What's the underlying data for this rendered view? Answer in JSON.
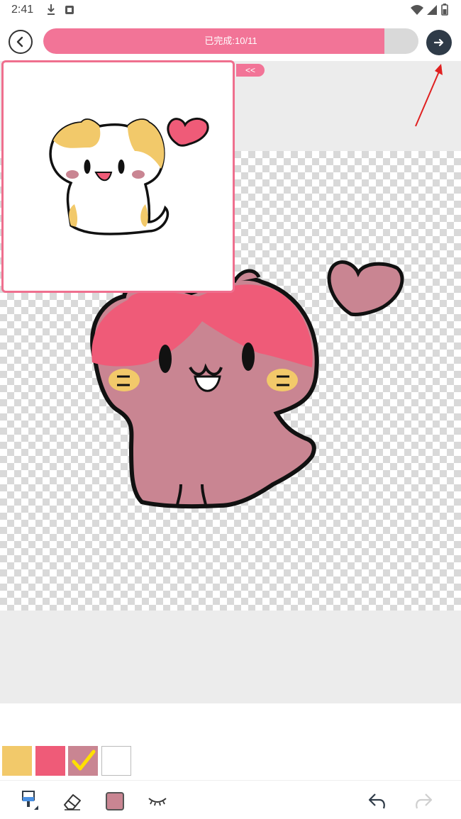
{
  "status_bar": {
    "time": "2:41",
    "icons": [
      "download-icon",
      "notification-icon",
      "wifi-icon",
      "signal-icon",
      "battery-icon"
    ]
  },
  "header": {
    "progress_label": "已完成:10/11",
    "progress_fraction": 0.909,
    "back_icon": "chevron-left-icon",
    "next_icon": "arrow-right-icon"
  },
  "reference_panel": {
    "collapse_label": "<<"
  },
  "palette": {
    "swatches": [
      {
        "color": "#f2c96a",
        "selected": false
      },
      {
        "color": "#ef5b78",
        "selected": false
      },
      {
        "color": "#c98592",
        "selected": true
      },
      {
        "color": "#ffffff",
        "selected": false
      }
    ],
    "check_icon": "check-icon"
  },
  "toolbar": {
    "tools": [
      "brush-icon",
      "eraser-icon",
      "current-color-icon",
      "eye-hide-icon",
      "undo-icon",
      "redo-icon"
    ],
    "current_color": "#c98592"
  },
  "colors": {
    "accent": "#f27497",
    "progress_track": "#d9d9d9",
    "next_button": "#2f3b48",
    "canvas_background": "#ececec"
  }
}
